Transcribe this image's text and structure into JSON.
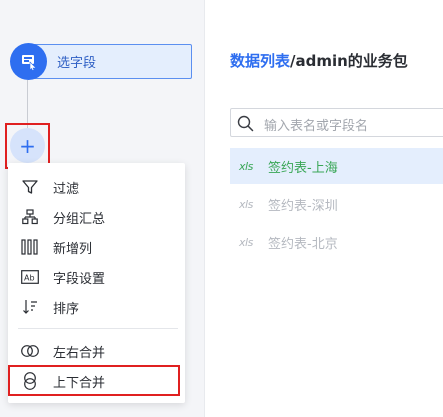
{
  "flow": {
    "node_label": "选字段",
    "add_symbol": "+"
  },
  "menu": {
    "items": [
      {
        "label": "过滤",
        "icon": "filter-icon"
      },
      {
        "label": "分组汇总",
        "icon": "group-summary-icon"
      },
      {
        "label": "新增列",
        "icon": "add-column-icon"
      },
      {
        "label": "字段设置",
        "icon": "field-settings-icon"
      },
      {
        "label": "排序",
        "icon": "sort-icon"
      },
      {
        "label": "左右合并",
        "icon": "horizontal-merge-icon"
      },
      {
        "label": "上下合并",
        "icon": "vertical-merge-icon"
      }
    ]
  },
  "panel": {
    "title_prefix": "数据列表",
    "title_suffix": "/admin的业务包",
    "search_placeholder": "输入表名或字段名",
    "tables": [
      {
        "icon_text": "xls",
        "label": "签约表-上海",
        "active": true
      },
      {
        "icon_text": "xls",
        "label": "签约表-深圳",
        "active": false
      },
      {
        "icon_text": "xls",
        "label": "签约表-北京",
        "active": false
      }
    ]
  },
  "colors": {
    "accent": "#2e6ef0",
    "highlight": "#e02020",
    "active_text": "#3aa757",
    "inactive_text": "#b5b9c0"
  }
}
